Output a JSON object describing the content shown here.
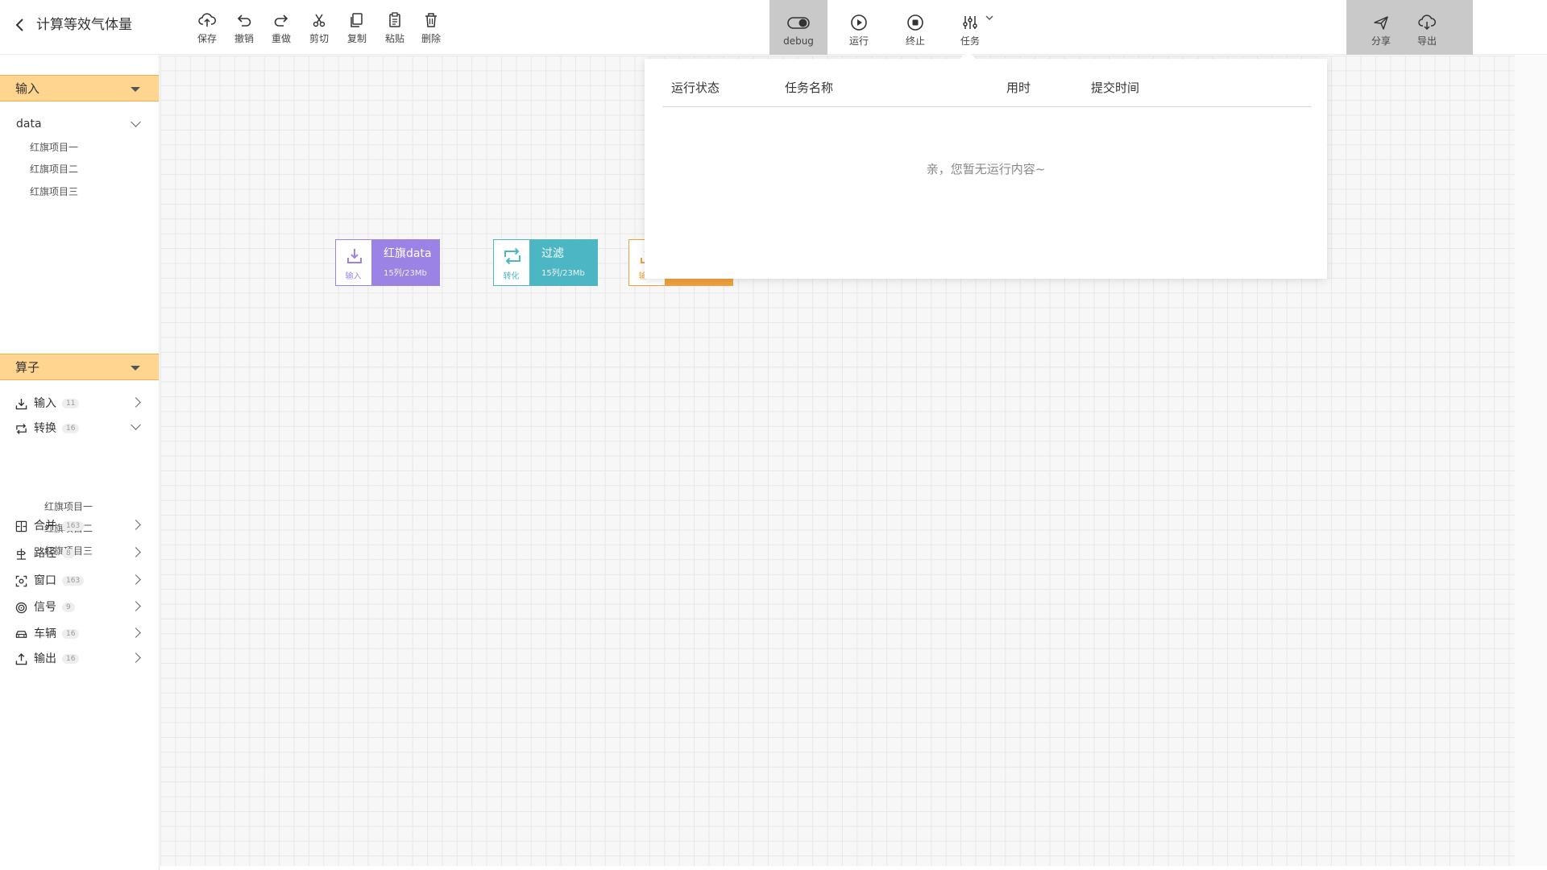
{
  "header": {
    "title": "计算等效气体量",
    "tools": [
      {
        "id": "save",
        "label": "保存",
        "icon": "cloud-upload-icon"
      },
      {
        "id": "undo",
        "label": "撤销",
        "icon": "undo-icon"
      },
      {
        "id": "redo",
        "label": "重做",
        "icon": "redo-icon"
      },
      {
        "id": "cut",
        "label": "剪切",
        "icon": "scissors-icon"
      },
      {
        "id": "copy",
        "label": "复制",
        "icon": "copy-icon"
      },
      {
        "id": "paste",
        "label": "粘贴",
        "icon": "paste-icon"
      },
      {
        "id": "delete",
        "label": "删除",
        "icon": "trash-icon"
      }
    ],
    "run_tools": [
      {
        "id": "debug",
        "label": "debug",
        "icon": "toggle-icon",
        "active": true
      },
      {
        "id": "run",
        "label": "运行",
        "icon": "play-icon"
      },
      {
        "id": "stop",
        "label": "终止",
        "icon": "stop-icon"
      },
      {
        "id": "task",
        "label": "任务",
        "icon": "sliders-icon"
      }
    ],
    "share_tools": [
      {
        "id": "share",
        "label": "分享",
        "icon": "send-icon"
      },
      {
        "id": "export",
        "label": "导出",
        "icon": "cloud-download-icon"
      }
    ]
  },
  "sidebar": {
    "input_section": {
      "title": "输入",
      "group": "data",
      "items": [
        "红旗项目一",
        "红旗项目二",
        "红旗项目三"
      ]
    },
    "operator_section": {
      "title": "算子",
      "categories": [
        {
          "label": "输入",
          "count": "11",
          "icon": "download-icon",
          "expanded": false
        },
        {
          "label": "转换",
          "count": "16",
          "icon": "transform-icon",
          "expanded": true,
          "children": [
            "红旗项目一",
            "红旗项目二",
            "红旗项目三"
          ]
        },
        {
          "label": "合并",
          "count": "163",
          "icon": "merge-icon",
          "expanded": false
        },
        {
          "label": "路径",
          "count": "8",
          "icon": "route-icon",
          "expanded": false
        },
        {
          "label": "窗口",
          "count": "163",
          "icon": "window-icon",
          "expanded": false
        },
        {
          "label": "信号",
          "count": "9",
          "icon": "signal-icon",
          "expanded": false
        },
        {
          "label": "车辆",
          "count": "16",
          "icon": "car-icon",
          "expanded": false
        },
        {
          "label": "输出",
          "count": "16",
          "icon": "upload-icon",
          "expanded": false
        }
      ]
    }
  },
  "canvas": {
    "nodes": [
      {
        "kind": "输入",
        "name": "红旗data",
        "stats": "15列/23Mb",
        "color": "#9b83e6",
        "icon": "download-icon"
      },
      {
        "kind": "转化",
        "name": "过滤",
        "stats": "15列/23Mb",
        "color": "#4cb6c4",
        "icon": "transform-icon"
      },
      {
        "kind": "输...",
        "name": "",
        "stats": "",
        "color": "#f0a13c",
        "icon": "upload-icon"
      }
    ]
  },
  "task_panel": {
    "columns": [
      "运行状态",
      "任务名称",
      "用时",
      "提交时间"
    ],
    "empty_text": "亲，您暂无运行内容~"
  },
  "colors": {
    "section_header": "#ffd58f",
    "section_border": "#f1b04f",
    "active_toolbar": "#c9c9c9"
  }
}
